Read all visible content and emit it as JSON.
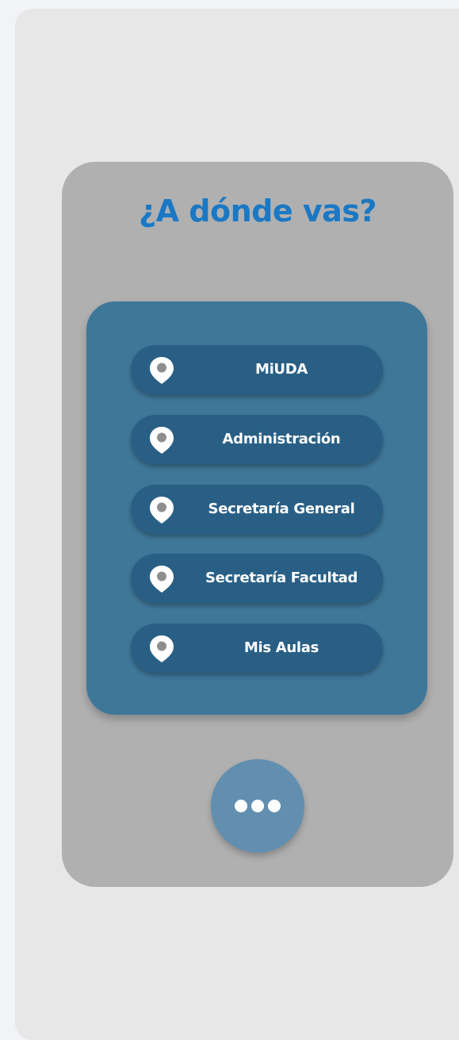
{
  "header": {
    "title": "¿A dónde vas?"
  },
  "menu": {
    "items": [
      {
        "label": "MiUDA",
        "icon": "location-pin-icon"
      },
      {
        "label": "Administración",
        "icon": "location-pin-icon"
      },
      {
        "label": "Secretaría General",
        "icon": "location-pin-icon"
      },
      {
        "label": "Secretaría Facultad",
        "icon": "location-pin-icon"
      },
      {
        "label": "Mis Aulas",
        "icon": "location-pin-icon"
      }
    ]
  },
  "more_button": {
    "icon": "more-dots-icon"
  },
  "colors": {
    "title": "#1a78c4",
    "panel": "#b0b0b0",
    "card": "#3f7799",
    "item": "#295f85",
    "more_button": "#628faf"
  }
}
